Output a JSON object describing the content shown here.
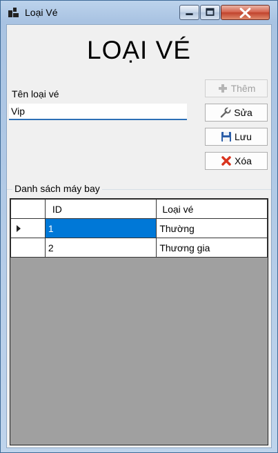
{
  "window": {
    "title": "Loại Vé"
  },
  "form": {
    "heading": "LOẠI VÉ",
    "name_label": "Tên loại vé",
    "name_value": "Vip"
  },
  "buttons": {
    "add": "Thêm",
    "edit": "Sửa",
    "save": "Lưu",
    "delete": "Xóa"
  },
  "group": {
    "label": "Danh sách máy bay"
  },
  "table": {
    "headers": [
      "ID",
      "Loại vé"
    ],
    "rows": [
      {
        "id": "1",
        "type": "Thường"
      },
      {
        "id": "2",
        "type": "Thương gia"
      }
    ]
  },
  "colors": {
    "selection": "#0078d7",
    "grid_empty": "#a0a0a0",
    "input_underline": "#2c6fb6"
  }
}
